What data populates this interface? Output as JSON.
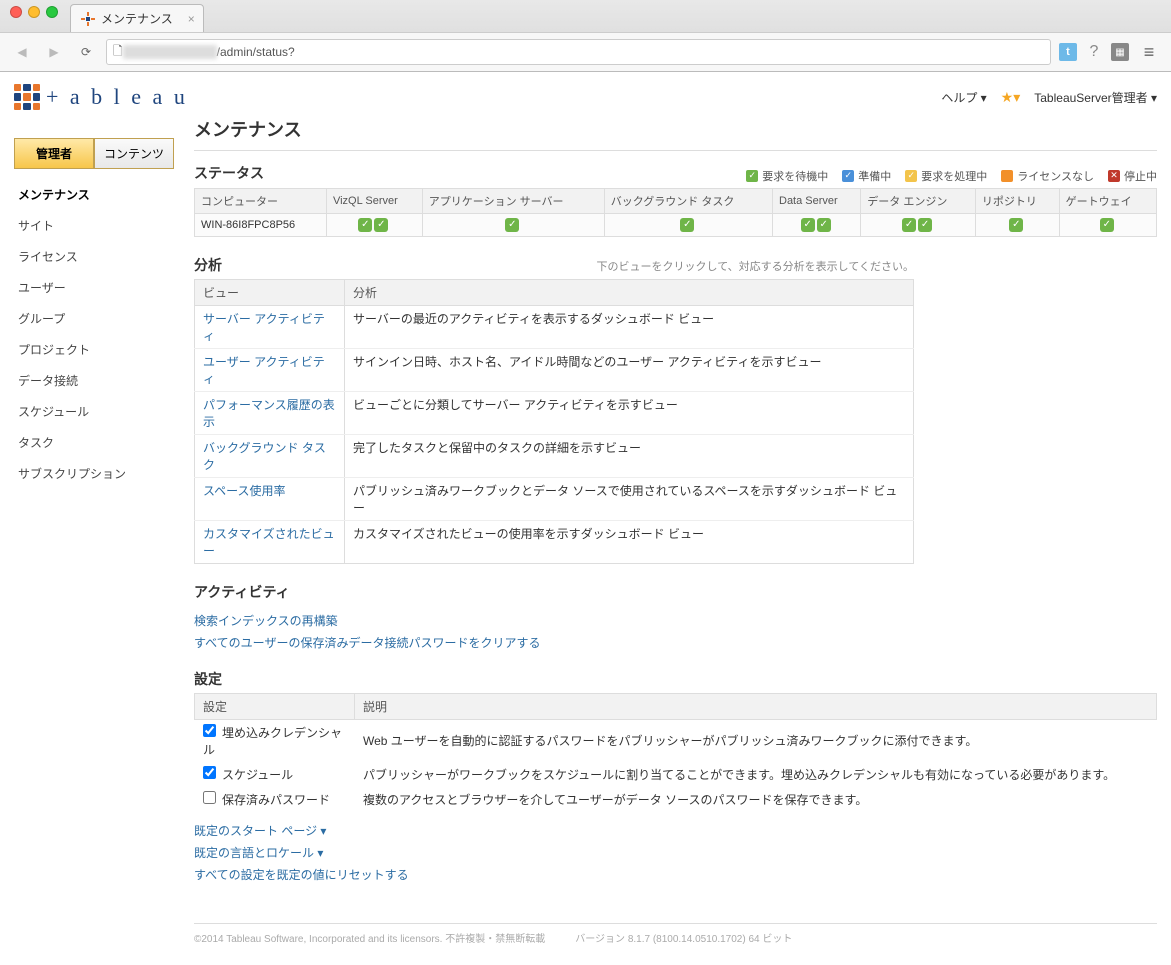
{
  "browser": {
    "tab_title": "メンテナンス",
    "url_path": "/admin/status?"
  },
  "header": {
    "logo_text": "+ a b l e a u",
    "help": "ヘルプ ▾",
    "star": "★▾",
    "user": "TableauServer管理者 ▾"
  },
  "sidebar": {
    "tab_admin": "管理者",
    "tab_content": "コンテンツ",
    "items": [
      "メンテナンス",
      "サイト",
      "ライセンス",
      "ユーザー",
      "グループ",
      "プロジェクト",
      "データ接続",
      "スケジュール",
      "タスク",
      "サブスクリプション"
    ]
  },
  "page_title": "メンテナンス",
  "status": {
    "title": "ステータス",
    "legend": [
      {
        "color": "green",
        "label": "要求を待機中",
        "check": true
      },
      {
        "color": "blue",
        "label": "準備中",
        "check": true
      },
      {
        "color": "yellow",
        "label": "要求を処理中",
        "check": true
      },
      {
        "color": "orange",
        "label": "ライセンスなし",
        "check": false
      },
      {
        "color": "red",
        "label": "停止中",
        "check": true,
        "x": true
      }
    ],
    "columns": [
      "コンピューター",
      "VizQL Server",
      "アプリケーション サーバー",
      "バックグラウンド タスク",
      "Data Server",
      "データ エンジン",
      "リポジトリ",
      "ゲートウェイ"
    ],
    "row": {
      "computer": "WIN-86I8FPC8P56",
      "checks": [
        2,
        1,
        1,
        2,
        2,
        1,
        1
      ]
    }
  },
  "analysis": {
    "title": "分析",
    "hint": "下のビューをクリックして、対応する分析を表示してください。",
    "col_view": "ビュー",
    "col_desc": "分析",
    "rows": [
      {
        "view": "サーバー アクティビティ",
        "desc": "サーバーの最近のアクティビティを表示するダッシュボード ビュー"
      },
      {
        "view": "ユーザー アクティビティ",
        "desc": "サインイン日時、ホスト名、アイドル時間などのユーザー アクティビティを示すビュー"
      },
      {
        "view": "パフォーマンス履歴の表示",
        "desc": "ビューごとに分類してサーバー アクティビティを示すビュー"
      },
      {
        "view": "バックグラウンド タスク",
        "desc": "完了したタスクと保留中のタスクの詳細を示すビュー"
      },
      {
        "view": "スペース使用率",
        "desc": "パブリッシュ済みワークブックとデータ ソースで使用されているスペースを示すダッシュボード ビュー"
      },
      {
        "view": "カスタマイズされたビュー",
        "desc": "カスタマイズされたビューの使用率を示すダッシュボード ビュー"
      }
    ]
  },
  "activity": {
    "title": "アクティビティ",
    "links": [
      "検索インデックスの再構築",
      "すべてのユーザーの保存済みデータ接続パスワードをクリアする"
    ]
  },
  "settings": {
    "title": "設定",
    "col_setting": "設定",
    "col_desc": "説明",
    "rows": [
      {
        "checked": true,
        "name": "埋め込みクレデンシャル",
        "desc": "Web ユーザーを自動的に認証するパスワードをパブリッシャーがパブリッシュ済みワークブックに添付できます。"
      },
      {
        "checked": true,
        "name": "スケジュール",
        "desc": "パブリッシャーがワークブックをスケジュールに割り当てることができます。埋め込みクレデンシャルも有効になっている必要があります。"
      },
      {
        "checked": false,
        "name": "保存済みパスワード",
        "desc": "複数のアクセスとブラウザーを介してユーザーがデータ ソースのパスワードを保存できます。"
      }
    ],
    "extra_links": [
      "既定のスタート ページ ▾",
      "既定の言語とロケール ▾",
      "すべての設定を既定の値にリセットする"
    ]
  },
  "footer": {
    "copyright": "©2014 Tableau Software, Incorporated and its licensors. 不許複製・禁無断転載",
    "version": "バージョン  8.1.7 (8100.14.0510.1702) 64 ビット"
  }
}
